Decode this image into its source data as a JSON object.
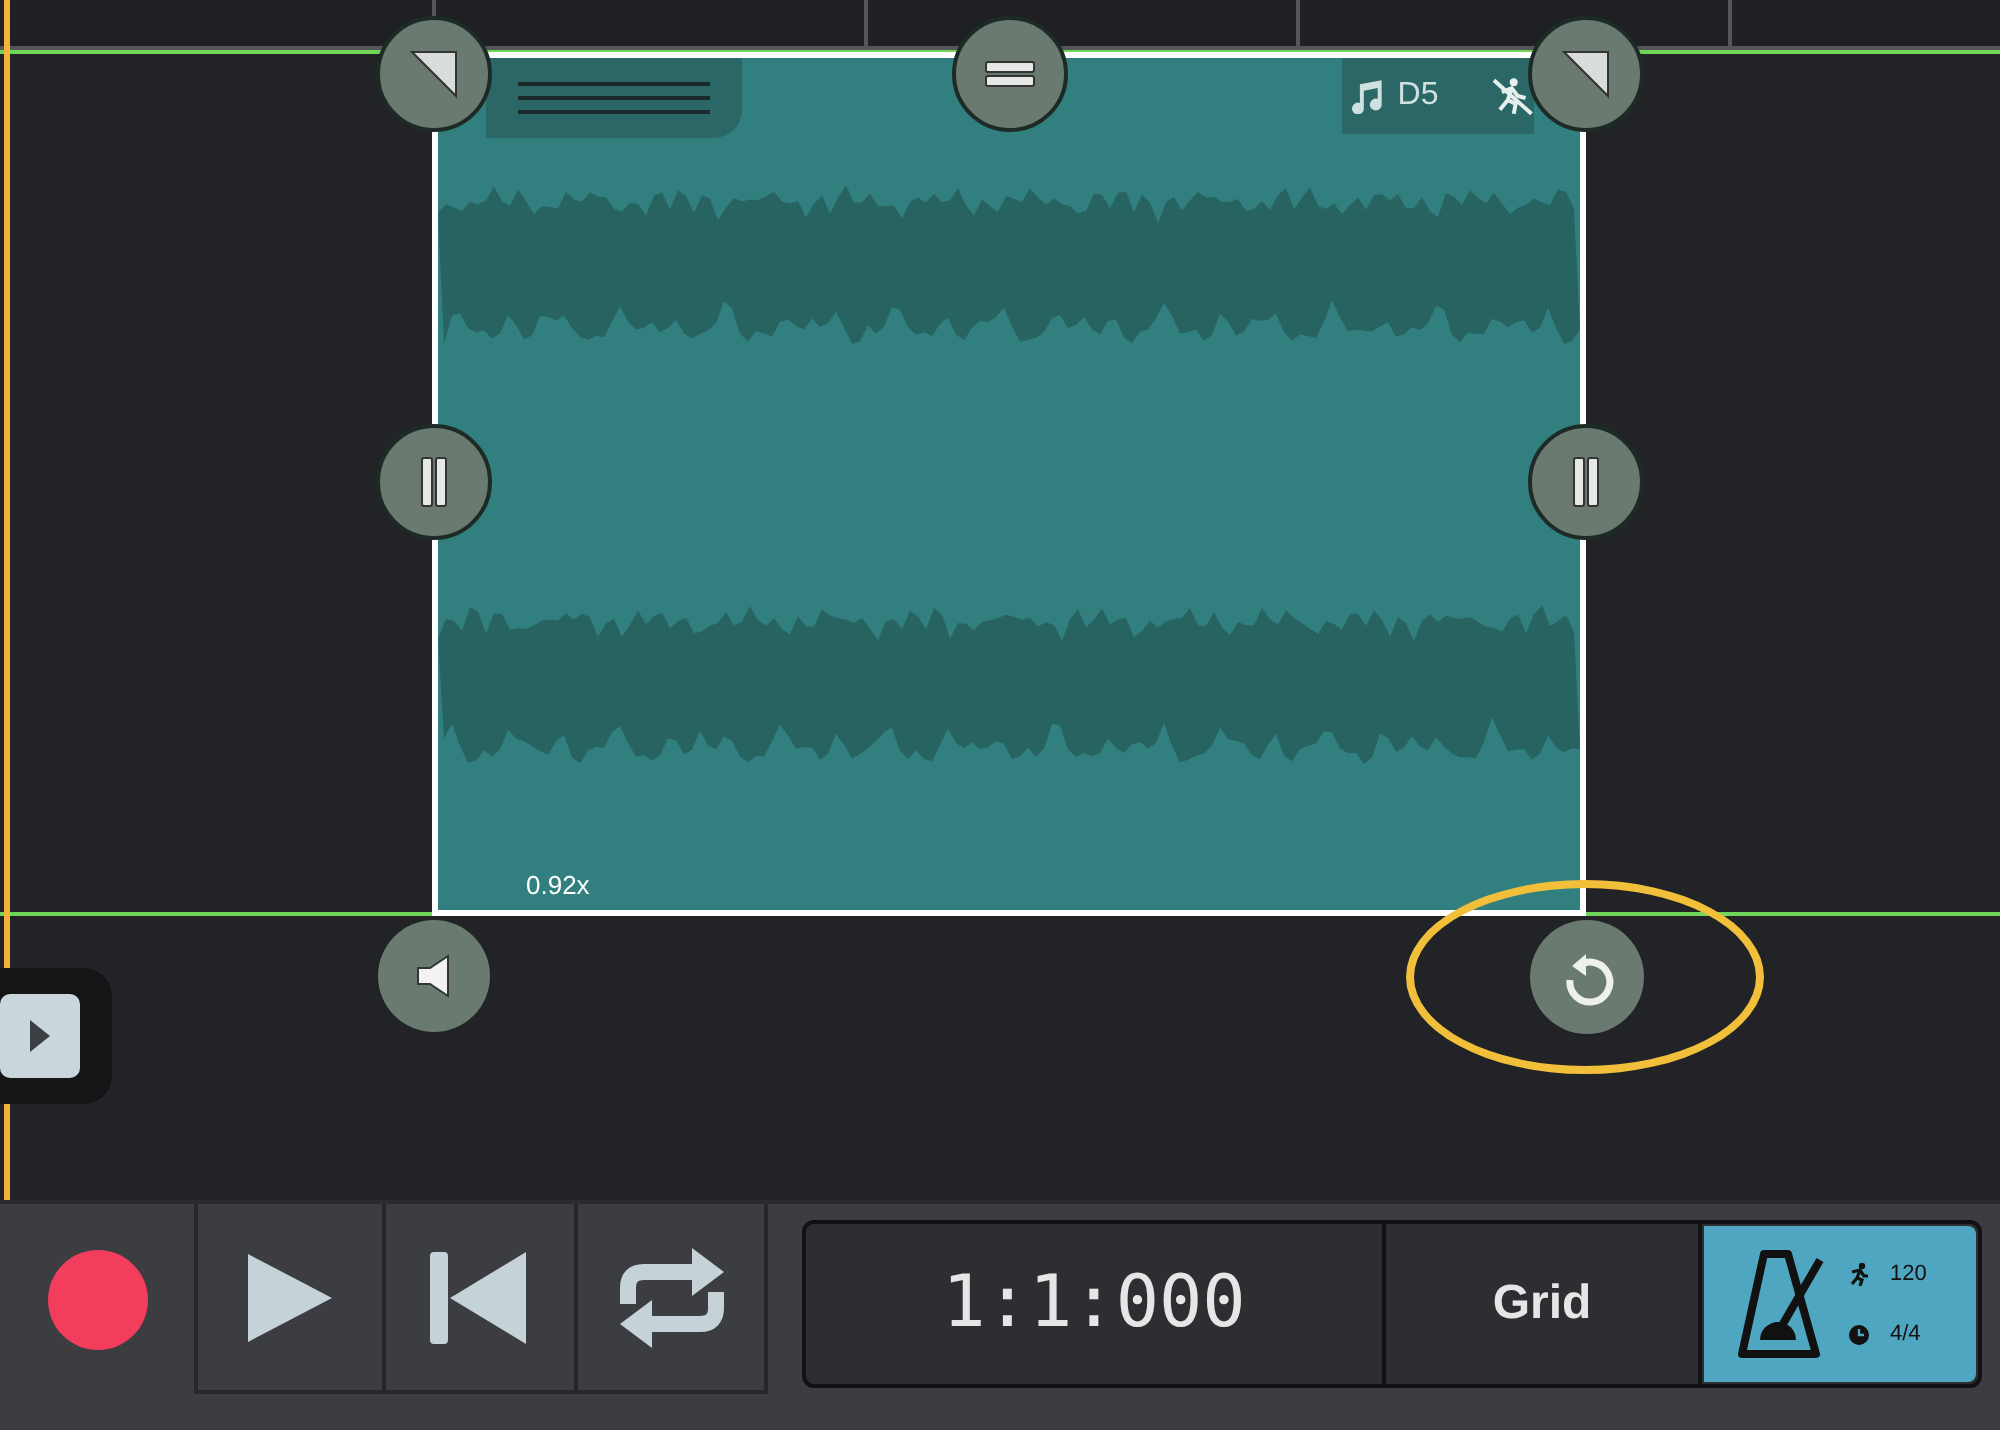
{
  "clip": {
    "pitch": "D5",
    "speed": "0.92x"
  },
  "transport": {
    "record_armed": true
  },
  "display": {
    "time": "1:1:000",
    "grid": "Grid",
    "tempo": "120",
    "time_signature": "4/4"
  }
}
